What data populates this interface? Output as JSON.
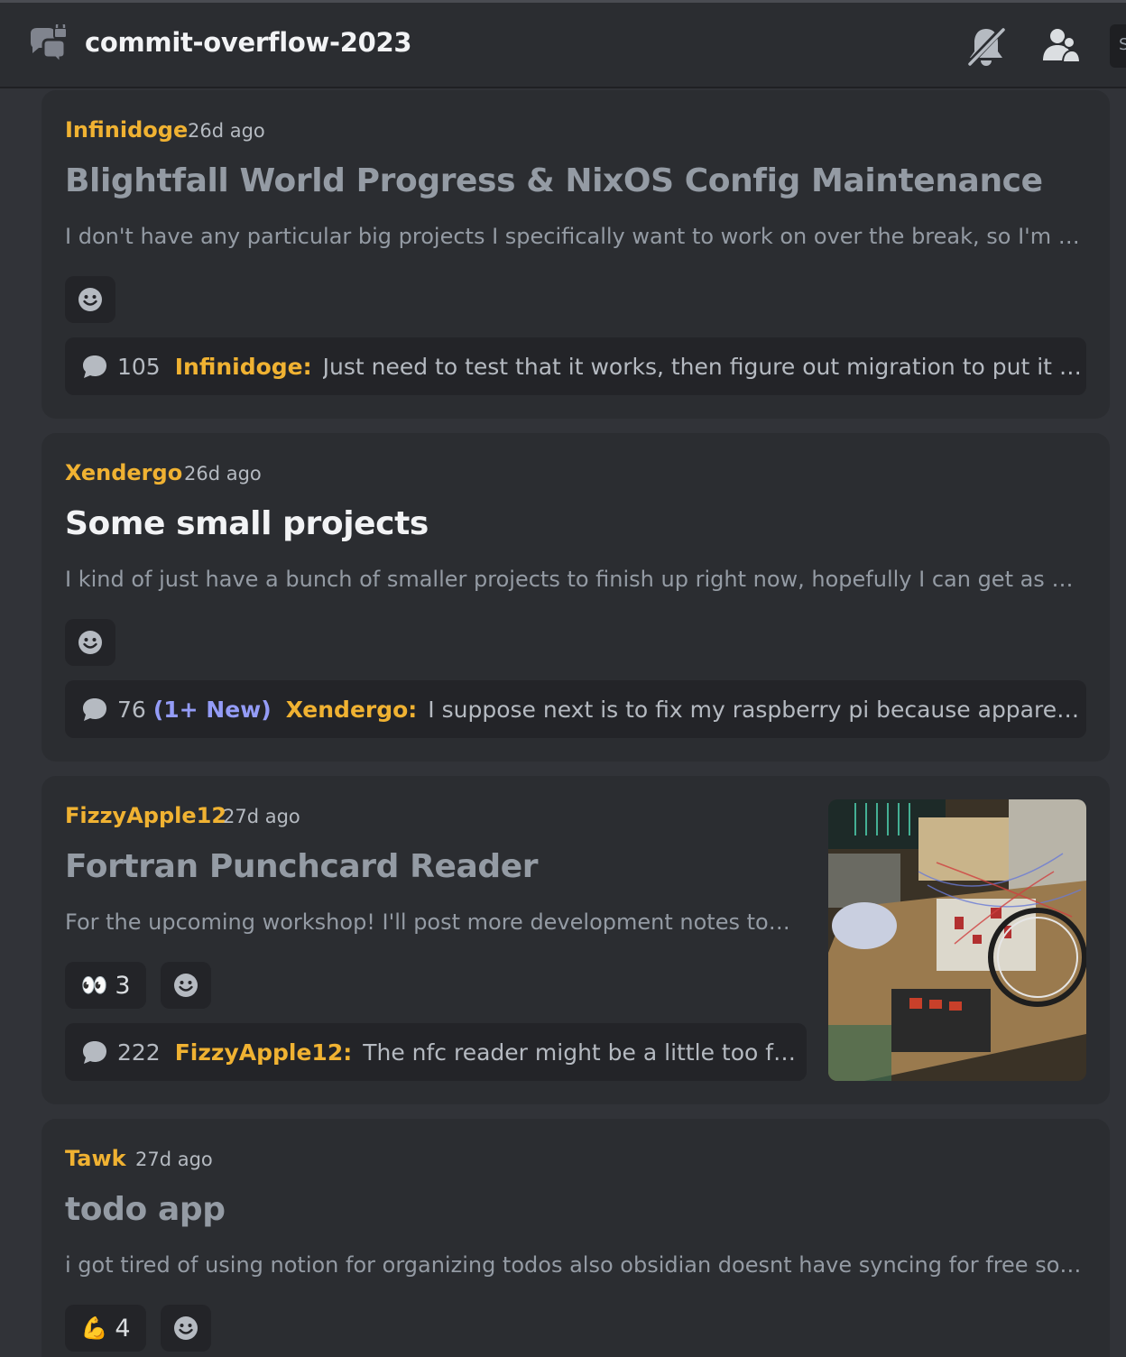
{
  "header": {
    "channel_name": "commit-overflow-2023",
    "search_hint": "S"
  },
  "posts": [
    {
      "author": "Infinidoge",
      "time": "26d ago",
      "title": "Blightfall World Progress & NixOS Config Maintenance",
      "preview": "I don't have any particular big projects I specifically want to work on over the break, so I'm bot...",
      "reply_count": "105",
      "last_author": "Infinidoge:",
      "last_message": "Just need to test that it works, then figure out migration to put it on th..."
    },
    {
      "author": "Xendergo",
      "time": "26d ago",
      "title": "Some small projects",
      "preview": "I kind of just have a bunch of smaller projects to finish up right now, hopefully I can get as man...",
      "reply_count": "76",
      "new_badge": "(1+ New)",
      "last_author": "Xendergo:",
      "last_message": "I suppose next is to fix my raspberry pi because apparently I rui..."
    },
    {
      "author": "FizzyApple12",
      "time": "27d ago",
      "title": "Fortran Punchcard Reader",
      "preview": "For the upcoming workshop! I'll post more development notes tomo...",
      "reaction_emoji": "👀",
      "reaction_count": "3",
      "reply_count": "222",
      "last_author": "FizzyApple12:",
      "last_message": "The nfc reader might be a little too far aw..."
    },
    {
      "author": "Tawk",
      "time": "27d ago",
      "title": "todo app",
      "preview": "i got tired of using notion for organizing todos also obsidian doesnt have syncing for free so i d...",
      "reaction_emoji": "💪",
      "reaction_count": "4"
    }
  ],
  "colors": {
    "author": "#f0b232",
    "new_badge": "#949cf7",
    "card_bg": "#2b2d31",
    "page_bg": "#313338"
  },
  "icons": [
    "forum-channel-icon",
    "bell-muted-icon",
    "members-icon",
    "add-reaction-icon",
    "reply-bubble-icon"
  ]
}
